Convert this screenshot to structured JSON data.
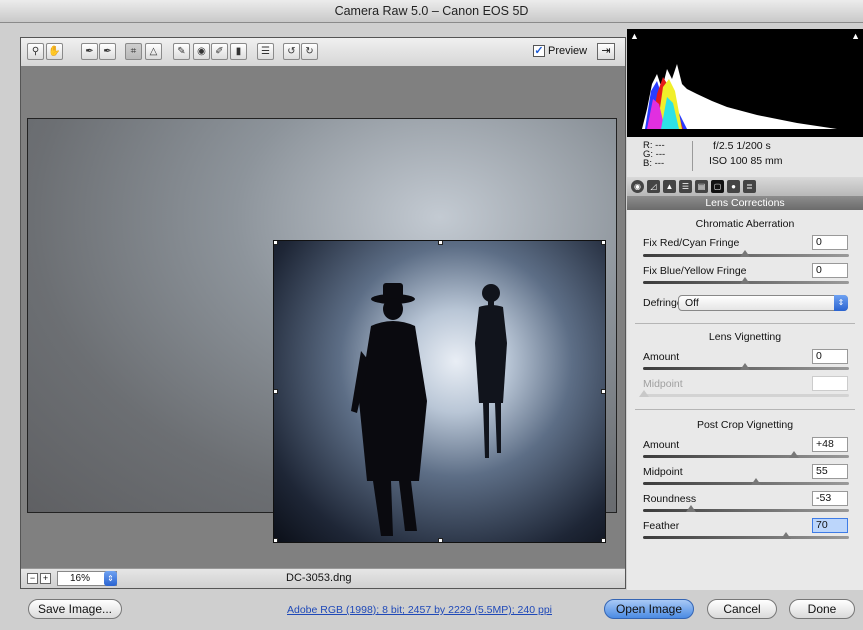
{
  "window": {
    "title": "Camera Raw 5.0  –  Canon EOS 5D"
  },
  "toolbar": {
    "tools": [
      {
        "name": "zoom-tool",
        "glyph": "⚲"
      },
      {
        "name": "hand-tool",
        "glyph": "✋"
      },
      {
        "name": "white-balance-tool",
        "glyph": "✒"
      },
      {
        "name": "color-sampler-tool",
        "glyph": "✒"
      },
      {
        "name": "crop-tool",
        "glyph": "⌗"
      },
      {
        "name": "straighten-tool",
        "glyph": "△"
      },
      {
        "name": "spot-removal-tool",
        "glyph": "✎"
      },
      {
        "name": "red-eye-tool",
        "glyph": "◉"
      },
      {
        "name": "adjustment-brush-tool",
        "glyph": "✐"
      },
      {
        "name": "graduated-filter-tool",
        "glyph": "▮"
      },
      {
        "name": "preferences-tool",
        "glyph": "☰"
      },
      {
        "name": "rotate-left-tool",
        "glyph": "↺"
      },
      {
        "name": "rotate-right-tool",
        "glyph": "↻"
      }
    ],
    "preview_label": "Preview",
    "preview_checked": true
  },
  "status": {
    "zoom": "16%",
    "filename": "DC-3053.dng"
  },
  "readout": {
    "r": "R:   ---",
    "g": "G:   ---",
    "b": "B:   ---",
    "exif_line1": "f/2.5   1/200 s",
    "exif_line2": "ISO 100   85 mm"
  },
  "panel": {
    "title": "Lens Corrections",
    "chromatic": {
      "heading": "Chromatic Aberration",
      "red_cyan_label": "Fix Red/Cyan Fringe",
      "red_cyan_value": "0",
      "blue_yellow_label": "Fix Blue/Yellow Fringe",
      "blue_yellow_value": "0",
      "defringe_label": "Defringe:",
      "defringe_value": "Off"
    },
    "vignetting": {
      "heading": "Lens Vignetting",
      "amount_label": "Amount",
      "amount_value": "0",
      "midpoint_label": "Midpoint",
      "midpoint_value": ""
    },
    "post_crop": {
      "heading": "Post Crop Vignetting",
      "amount_label": "Amount",
      "amount_value": "+48",
      "midpoint_label": "Midpoint",
      "midpoint_value": "55",
      "roundness_label": "Roundness",
      "roundness_value": "-53",
      "feather_label": "Feather",
      "feather_value": "70"
    }
  },
  "footer": {
    "save_label": "Save Image...",
    "workflow_link": "Adobe RGB (1998); 8 bit; 2457 by 2229 (5.5MP); 240 ppi",
    "open_label": "Open Image",
    "cancel_label": "Cancel",
    "done_label": "Done"
  },
  "colors": {
    "accent": "#2a63d0",
    "panel_bg": "#e9e9e9",
    "link": "#1f49b8"
  }
}
